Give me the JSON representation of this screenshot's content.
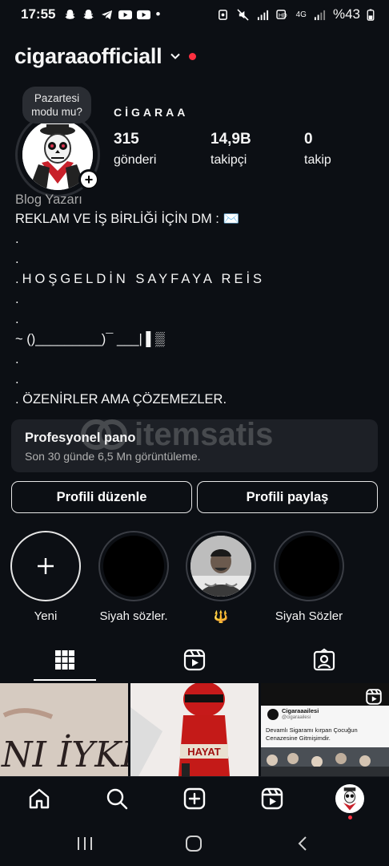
{
  "status_bar": {
    "time": "17:55",
    "dot": "•",
    "network": "4G",
    "battery": "%43"
  },
  "header": {
    "username": "cigaraaofficiall"
  },
  "profile": {
    "note_bubble": "Pazartesi modu mu?",
    "display_name": "CİGARAA",
    "stats": [
      {
        "value": "315",
        "label": "gönderi"
      },
      {
        "value": "14,9B",
        "label": "takipçi"
      },
      {
        "value": "0",
        "label": "takip"
      }
    ],
    "category": "Blog Yazarı",
    "bio_lines": [
      "REKLAM VE İŞ BİRLİĞİ İÇİN DM : ✉️",
      ".",
      ".",
      ".HOŞGELDİN SAYFAYA REİS",
      ".",
      ".",
      "~ ()_________)¯ ___| ▌▒",
      ".",
      ".",
      ". ÖZENİRLER AMA ÇÖZEMEZLER."
    ]
  },
  "dashboard": {
    "title": "Profesyonel pano",
    "subtitle": "Son 30 günde 6,5 Mn görüntüleme."
  },
  "buttons": {
    "edit": "Profili düzenle",
    "share": "Profili paylaş"
  },
  "highlights": [
    {
      "label": "Yeni"
    },
    {
      "label": "Siyah sözler."
    },
    {
      "label": "🔱"
    },
    {
      "label": "Siyah Sözler"
    }
  ],
  "grid_posts": {
    "post3_title": "Cigaraaailesi",
    "post3_handle": "@cigaraailesi",
    "post3_text": "Devamlı Sigaramı kırpan Çocuğun Cenazesine Gitmişimdir.",
    "post2_sign": "HAYAT"
  },
  "watermark": "itemsatis"
}
